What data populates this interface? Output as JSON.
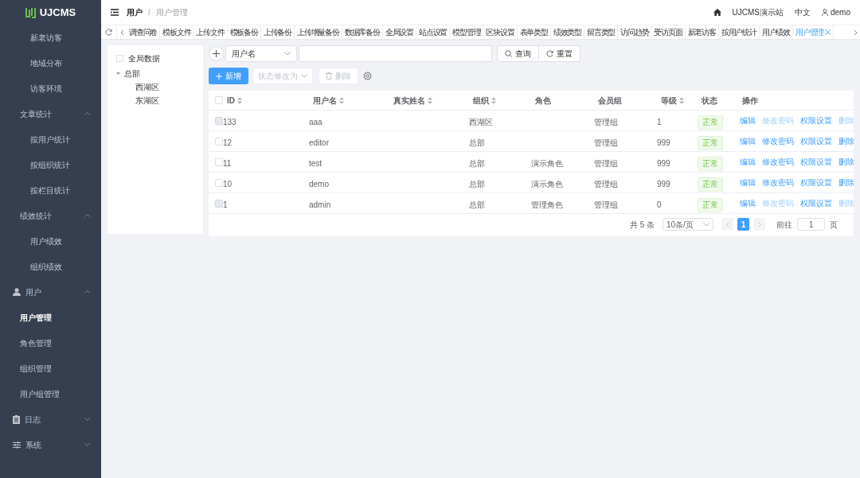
{
  "sidebar": {
    "logo": "UJCMS",
    "items": [
      {
        "children": [
          {
            "children": [
              {
                "label": "新老访客",
                "selected": false
              },
              {
                "label": "地域分布",
                "selected": false
              },
              {
                "label": "访客环境",
                "selected": false
              }
            ]
          },
          {
            "label": "文章统计",
            "expanded": true,
            "children": [
              {
                "label": "按用户统计",
                "selected": false
              },
              {
                "label": "按组织统计",
                "selected": false
              },
              {
                "label": "按栏目统计",
                "selected": false
              }
            ]
          },
          {
            "label": "绩效统计",
            "expanded": true,
            "children": [
              {
                "label": "用户绩效",
                "selected": false
              },
              {
                "label": "组织绩效",
                "selected": false
              }
            ]
          }
        ]
      },
      {
        "label": "用户",
        "kind": "user",
        "expanded": true,
        "children": [
          {
            "label": "用户管理",
            "selected": true
          },
          {
            "label": "角色管理",
            "selected": false
          },
          {
            "label": "组织管理",
            "selected": false
          },
          {
            "label": "用户组管理",
            "selected": false
          }
        ]
      },
      {
        "label": "日志",
        "kind": "log",
        "expanded": false
      },
      {
        "label": "系统",
        "kind": "system",
        "expanded": false
      }
    ]
  },
  "header": {
    "breadcrumb": [
      "用户",
      "用户管理"
    ],
    "separator": "/",
    "site": "UJCMS演示站",
    "language": "中文",
    "user": "demo"
  },
  "tabs": [
    {
      "label": "调查问卷",
      "selected": false
    },
    {
      "label": "模板文件",
      "selected": false
    },
    {
      "label": "上传文件",
      "selected": false
    },
    {
      "label": "模板备份",
      "selected": false
    },
    {
      "label": "上传备份",
      "selected": false
    },
    {
      "label": "上传增量备份",
      "selected": false
    },
    {
      "label": "数据库备份",
      "selected": false
    },
    {
      "label": "全局设置",
      "selected": false
    },
    {
      "label": "站点设置",
      "selected": false
    },
    {
      "label": "模型管理",
      "selected": false
    },
    {
      "label": "区块设置",
      "selected": false
    },
    {
      "label": "表单类型",
      "selected": false
    },
    {
      "label": "绩效类型",
      "selected": false
    },
    {
      "label": "留言类型",
      "selected": false
    },
    {
      "label": "访问趋势",
      "selected": false
    },
    {
      "label": "受访页面",
      "selected": false
    },
    {
      "label": "新老访客",
      "selected": false
    },
    {
      "label": "按用户统计",
      "selected": false
    },
    {
      "label": "用户绩效",
      "selected": false
    },
    {
      "label": "用户管理",
      "selected": true
    }
  ],
  "tree": {
    "global": {
      "label": "全局数据",
      "checked": false
    },
    "nodes": [
      {
        "label": "总部",
        "expanded": true,
        "children": [
          {
            "label": "西湖区"
          },
          {
            "label": "东湖区"
          }
        ]
      }
    ]
  },
  "search": {
    "field": "用户名",
    "query_button": "查询",
    "reset_button": "重置"
  },
  "toolbar": {
    "add": "新增",
    "status": {
      "label": "状态修改为",
      "disabled": true
    },
    "delete": {
      "label": "删除",
      "disabled": true
    }
  },
  "table": {
    "select_all": {
      "checked": false
    },
    "columns": [
      {
        "label": "ID",
        "sortable": true
      },
      {
        "label": "用户名",
        "sortable": true
      },
      {
        "label": "真实姓名",
        "sortable": true
      },
      {
        "label": "组织",
        "sortable": true
      },
      {
        "label": "角色",
        "sortable": false
      },
      {
        "label": "会员组",
        "sortable": false
      },
      {
        "label": "等级",
        "sortable": true
      },
      {
        "label": "状态",
        "sortable": false
      },
      {
        "label": "操作",
        "sortable": false
      }
    ],
    "rows": [
      {
        "checkbox_disabled": true,
        "cells": [
          "133",
          "aaa",
          "",
          "西湖区",
          "",
          "管理组",
          "1"
        ],
        "status": "正常",
        "actions": [
          {
            "label": "编辑",
            "disabled": false
          },
          {
            "label": "修改密码",
            "disabled": true
          },
          {
            "label": "权限设置",
            "disabled": false
          },
          {
            "label": "删除",
            "disabled": true
          }
        ]
      },
      {
        "checkbox_disabled": false,
        "cells": [
          "12",
          "editor",
          "",
          "总部",
          "",
          "管理组",
          "999"
        ],
        "status": "正常",
        "actions": [
          {
            "label": "编辑",
            "disabled": false
          },
          {
            "label": "修改密码",
            "disabled": false
          },
          {
            "label": "权限设置",
            "disabled": false
          },
          {
            "label": "删除",
            "disabled": false
          }
        ]
      },
      {
        "checkbox_disabled": false,
        "cells": [
          "11",
          "test",
          "",
          "总部",
          "演示角色",
          "管理组",
          "999"
        ],
        "status": "正常",
        "actions": [
          {
            "label": "编辑",
            "disabled": false
          },
          {
            "label": "修改密码",
            "disabled": false
          },
          {
            "label": "权限设置",
            "disabled": false
          },
          {
            "label": "删除",
            "disabled": false
          }
        ]
      },
      {
        "checkbox_disabled": false,
        "cells": [
          "10",
          "demo",
          "",
          "总部",
          "演示角色",
          "管理组",
          "999"
        ],
        "status": "正常",
        "actions": [
          {
            "label": "编辑",
            "disabled": false
          },
          {
            "label": "修改密码",
            "disabled": false
          },
          {
            "label": "权限设置",
            "disabled": false
          },
          {
            "label": "删除",
            "disabled": false
          }
        ]
      },
      {
        "checkbox_disabled": true,
        "cells": [
          "1",
          "admin",
          "",
          "总部",
          "管理角色",
          "管理组",
          "0"
        ],
        "status": "正常",
        "actions": [
          {
            "label": "编辑",
            "disabled": false
          },
          {
            "label": "修改密码",
            "disabled": true
          },
          {
            "label": "权限设置",
            "disabled": false
          },
          {
            "label": "删除",
            "disabled": true
          }
        ]
      }
    ]
  },
  "pagination": {
    "total": "共 5 条",
    "page_size": "10条/页",
    "pages": [
      {
        "label": "1",
        "selected": true
      }
    ],
    "goto_label": "前往",
    "goto_value": "1",
    "page_suffix": "页"
  }
}
